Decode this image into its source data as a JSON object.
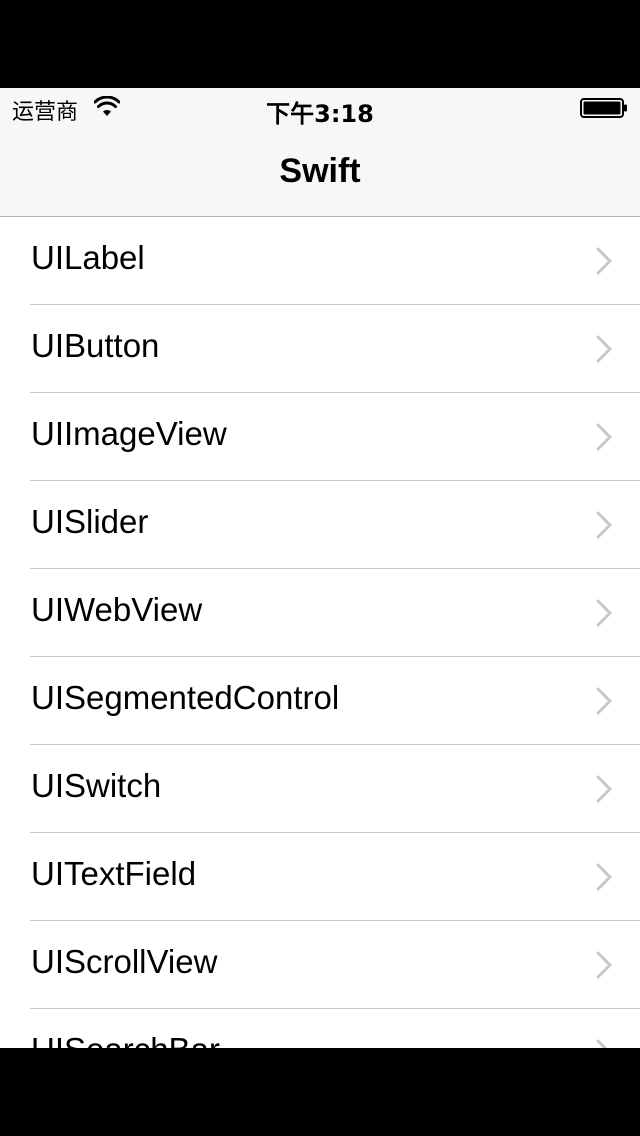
{
  "status_bar": {
    "carrier": "运营商",
    "time": "下午3:18",
    "icons": [
      "wifi-icon",
      "battery-icon"
    ]
  },
  "nav": {
    "title": "Swift"
  },
  "list": {
    "items": [
      {
        "label": "UILabel"
      },
      {
        "label": "UIButton"
      },
      {
        "label": "UIImageView"
      },
      {
        "label": "UISlider"
      },
      {
        "label": "UIWebView"
      },
      {
        "label": "UISegmentedControl"
      },
      {
        "label": "UISwitch"
      },
      {
        "label": "UITextField"
      },
      {
        "label": "UIScrollView"
      },
      {
        "label": "UISearchBar"
      }
    ],
    "accessory_icon": "chevron-right-icon"
  },
  "colors": {
    "bar_background": "#f7f7f7",
    "separator": "#c8c7cc",
    "chevron": "#c7c7cc",
    "letterbox": "#000000"
  }
}
